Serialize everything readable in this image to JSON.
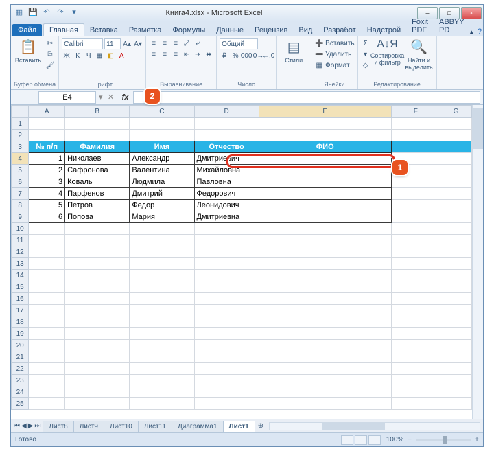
{
  "titlebar": {
    "text": "Книга4.xlsx - Microsoft Excel"
  },
  "win_controls": {
    "min": "–",
    "max": "□",
    "close": "×"
  },
  "qat": {
    "save": "💾",
    "undo": "↶",
    "redo": "↷"
  },
  "ribbon_tabs": {
    "file": "Файл",
    "home": "Главная",
    "insert": "Вставка",
    "layout": "Разметка",
    "formulas": "Формулы",
    "data": "Данные",
    "review": "Рецензив",
    "view": "Вид",
    "developer": "Разработ",
    "addins": "Надстрой",
    "foxit": "Foxit PDF",
    "abbyy": "ABBYY PD"
  },
  "ribbon": {
    "paste": {
      "label": "Вставить",
      "group": "Буфер обмена"
    },
    "font": {
      "name": "Calibri",
      "size": "11",
      "group": "Шрифт",
      "bold": "Ж",
      "italic": "К",
      "underline": "Ч"
    },
    "align": {
      "group": "Выравнивание",
      "wrap_on": "⤶"
    },
    "number": {
      "format": "Общий",
      "group": "Число",
      "percent": "%",
      "comma": "000"
    },
    "styles": {
      "label": "Стили"
    },
    "cells": {
      "insert": "Вставить",
      "delete": "Удалить",
      "format": "Формат",
      "group": "Ячейки"
    },
    "editing": {
      "sort": "Сортировка и фильтр",
      "find": "Найти и выделить",
      "group": "Редактирование"
    }
  },
  "formulabar": {
    "name_box": "E4",
    "fx": "fx"
  },
  "callouts": {
    "one": "1",
    "two": "2"
  },
  "columns": [
    "A",
    "B",
    "C",
    "D",
    "E",
    "F",
    "G"
  ],
  "rows": [
    "1",
    "2",
    "3",
    "4",
    "5",
    "6",
    "7",
    "8",
    "9",
    "10",
    "11",
    "12",
    "13",
    "14",
    "15",
    "16",
    "17",
    "18",
    "19",
    "20",
    "21",
    "22",
    "23",
    "24",
    "25"
  ],
  "headers": {
    "num": "№ п/п",
    "fam": "Фамилия",
    "name": "Имя",
    "patr": "Отчество",
    "fio": "ФИО"
  },
  "data": [
    {
      "n": "1",
      "f": "Николаев",
      "i": "Александр",
      "o": "Дмитриевич"
    },
    {
      "n": "2",
      "f": "Сафронова",
      "i": "Валентина",
      "o": "Михайловна"
    },
    {
      "n": "3",
      "f": "Коваль",
      "i": "Людмила",
      "o": "Павловна"
    },
    {
      "n": "4",
      "f": "Парфенов",
      "i": "Дмитрий",
      "o": "Федорович"
    },
    {
      "n": "5",
      "f": "Петров",
      "i": "Федор",
      "o": "Леонидович"
    },
    {
      "n": "6",
      "f": "Попова",
      "i": "Мария",
      "o": "Дмитриевна"
    }
  ],
  "sheet_tabs": {
    "t1": "Лист8",
    "t2": "Лист9",
    "t3": "Лист10",
    "t4": "Лист11",
    "t5": "Диаграмма1",
    "active": "Лист1"
  },
  "status": {
    "text": "Готово",
    "zoom": "100%"
  }
}
